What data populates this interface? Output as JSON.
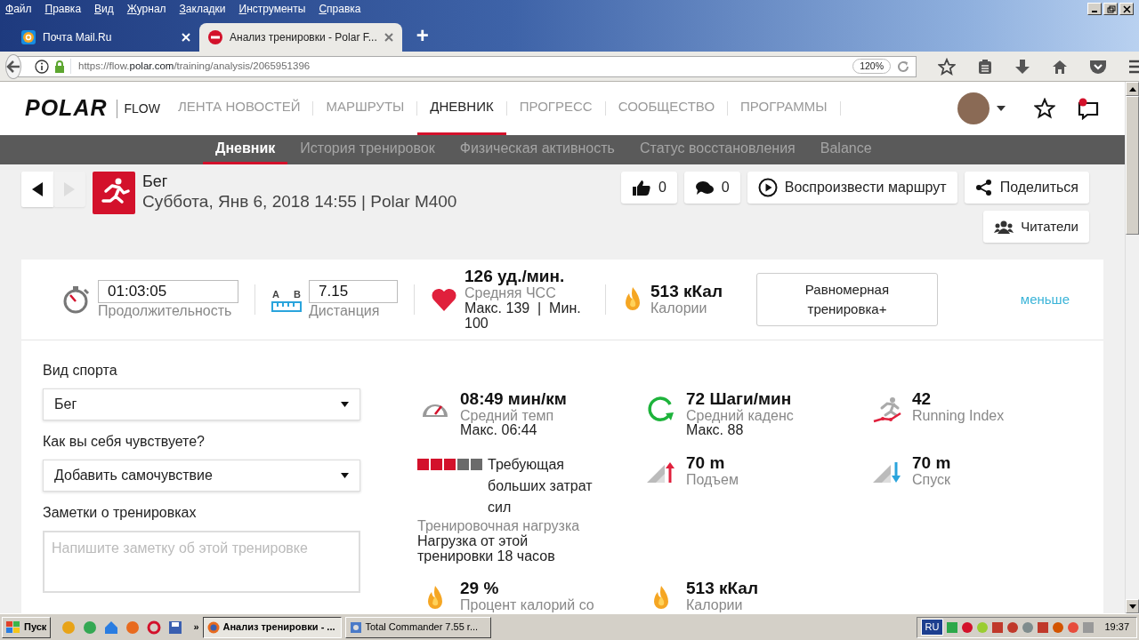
{
  "browser": {
    "menu": [
      "Файл",
      "Правка",
      "Вид",
      "Журнал",
      "Закладки",
      "Инструменты",
      "Справка"
    ],
    "tabs": [
      {
        "title": "Почта Mail.Ru",
        "kind": "mail",
        "selected": false
      },
      {
        "title": "Анализ тренировки - Polar F...",
        "kind": "polar",
        "selected": true
      }
    ],
    "new_tab": "+",
    "url_host": "https://flow.",
    "url_domain": "polar.com",
    "url_path": "/training/analysis/2065951396",
    "zoom": "120%"
  },
  "site": {
    "logo": "POLAR",
    "product": "FLOW",
    "nav": [
      {
        "label": "ЛЕНТА НОВОСТЕЙ",
        "selected": false
      },
      {
        "label": "МАРШРУТЫ",
        "selected": false
      },
      {
        "label": "ДНЕВНИК",
        "selected": true
      },
      {
        "label": "ПРОГРЕСС",
        "selected": false
      },
      {
        "label": "СООБЩЕСТВО",
        "selected": false
      },
      {
        "label": "ПРОГРАММЫ",
        "selected": false
      }
    ],
    "notification": true
  },
  "subnav": [
    {
      "label": "Дневник",
      "selected": true
    },
    {
      "label": "История тренировок",
      "selected": false
    },
    {
      "label": "Физическая активность",
      "selected": false
    },
    {
      "label": "Статус восстановления",
      "selected": false
    },
    {
      "label": "Balance",
      "selected": false
    }
  ],
  "workout": {
    "sport": "Бег",
    "subtitle": "Суббота, Янв 6, 2018 14:55 | Polar M400",
    "next_disabled": true
  },
  "actions": [
    {
      "kind": "like",
      "label": "0"
    },
    {
      "kind": "comment",
      "label": "0"
    },
    {
      "kind": "play",
      "label": "Воспроизвести маршрут"
    },
    {
      "kind": "share",
      "label": "Поделиться"
    },
    {
      "kind": "followers",
      "label": "Читатели"
    }
  ],
  "summary": {
    "duration": {
      "value": "01:03:05",
      "label": "Продолжительность"
    },
    "distance": {
      "point_a": "A",
      "point_b": "B",
      "value": "7.15",
      "label": "Дистанция"
    },
    "heart_rate": {
      "value": "126 уд./мин.",
      "label": "Средняя ЧСС",
      "detail": "Макс. 139  |  Мин. 100"
    },
    "calories": {
      "value": "513 кКал",
      "label": "Калории"
    },
    "benefit": "Равномерная тренировка+",
    "less": "меньше"
  },
  "form": {
    "sport_label": "Вид спорта",
    "sport_value": "Бег",
    "feeling_label": "Как вы себя чувствуете?",
    "feeling_value": "Добавить самочувствие",
    "notes_label": "Заметки о тренировках",
    "notes_placeholder": "Напишите заметку об этой тренировке"
  },
  "stats": [
    {
      "kind": "pace",
      "value": "08:49 мин/км",
      "label": "Средний темп",
      "detail": "Макс. 06:44"
    },
    {
      "kind": "cadence",
      "value": "72 Шаги/мин",
      "label": "Средний каденс",
      "detail": "Макс. 88"
    },
    {
      "kind": "running_index",
      "value": "42",
      "label": "Running Index"
    },
    {
      "kind": "load",
      "title": "Требующая больших затрат сил",
      "stars": 3,
      "label": "Тренировочная нагрузка",
      "detail": "Нагрузка от этой тренировки 18 часов"
    },
    {
      "kind": "ascent",
      "value": "70 m",
      "label": "Подъем"
    },
    {
      "kind": "descent",
      "value": "70 m",
      "label": "Спуск"
    },
    {
      "kind": "fat",
      "value": "29 %",
      "label": "Процент калорий со"
    },
    {
      "kind": "calories",
      "value": "513 кКал",
      "label": "Калории"
    }
  ],
  "taskbar": {
    "start": "Пуск",
    "more": "»",
    "windows": [
      {
        "title": "Анализ тренировки - ...",
        "kind": "firefox",
        "selected": true
      },
      {
        "title": "Total Commander 7.55 r...",
        "kind": "commander",
        "selected": false
      }
    ],
    "lang": "RU",
    "time": "19:37"
  }
}
